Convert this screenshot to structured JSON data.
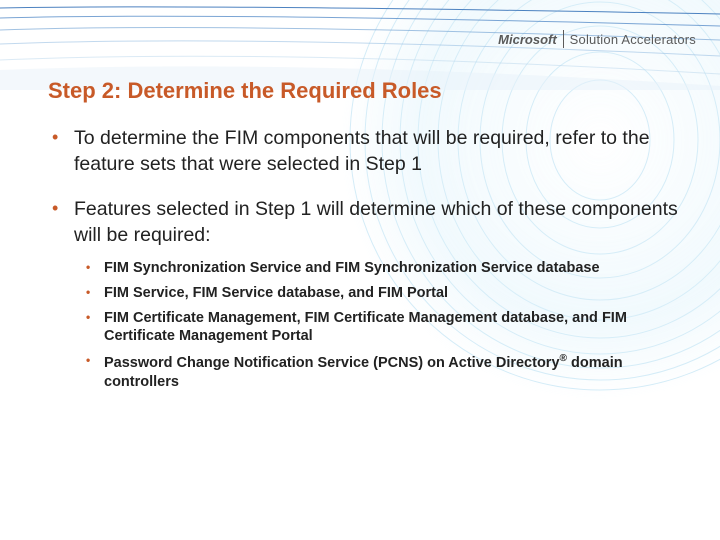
{
  "brand": {
    "microsoft": "Microsoft",
    "product": "Solution Accelerators"
  },
  "title": "Step 2: Determine the Required Roles",
  "bullets": [
    {
      "text": "To determine the FIM components that will be required, refer to the feature sets that were selected in Step 1"
    },
    {
      "text": "Features selected in Step 1 will determine which of these components will be required:",
      "sub": [
        "FIM Synchronization Service and FIM Synchronization Service database",
        "FIM Service, FIM Service database, and FIM Portal",
        "FIM Certificate Management, FIM Certificate Management database, and FIM Certificate Management Portal",
        "Password Change Notification Service (PCNS) on Active Directory® domain controllers"
      ]
    }
  ]
}
